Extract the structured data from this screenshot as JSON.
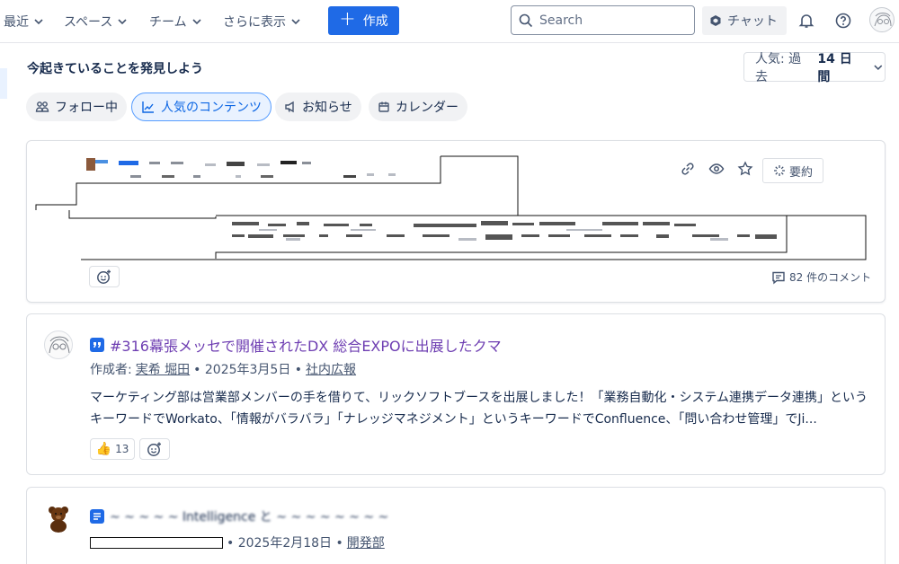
{
  "nav": {
    "recent": "最近",
    "spaces": "スペース",
    "teams": "チーム",
    "more": "さらに表示",
    "create": "作成",
    "search_placeholder": "Search",
    "chat": "チャット"
  },
  "feed": {
    "title": "今起きていることを発見しよう",
    "sort_label": "人気: 過去",
    "sort_value": "14 日間",
    "chips": [
      "フォロー中",
      "人気のコンテンツ",
      "お知らせ",
      "カレンダー"
    ]
  },
  "card1": {
    "summary_label": "要約",
    "comments": "82 件のコメント"
  },
  "card2": {
    "title": "#316幕張メッセで開催されたDX 総合EXPOに出展したクマ",
    "author_prefix": "作成者:",
    "author": "実希 堀田",
    "date": "• 2025年3月5日 •",
    "space": "社内広報",
    "body": "マーケティング部は営業部メンバーの手を借りて、リックソフトブースを出展しました！「業務自動化・システム連携データ連携」というキーワードでWorkato、「情報がバラバラ」「ナレッジマネジメント」というキーワードでConfluence、「問い合わせ管理」でJi...",
    "likes": "13"
  },
  "card3": {
    "title": "~ ~ ~ ~ ~ Intelligence と ~ ~ ~ ~ ~ ~ ~ ~",
    "date": "• 2025年2月18日 •",
    "space": "開発部"
  },
  "colors": {
    "primary": "#1f6ae6",
    "title_purple": "#6e3eb2",
    "chip_active_border": "#579dff"
  }
}
